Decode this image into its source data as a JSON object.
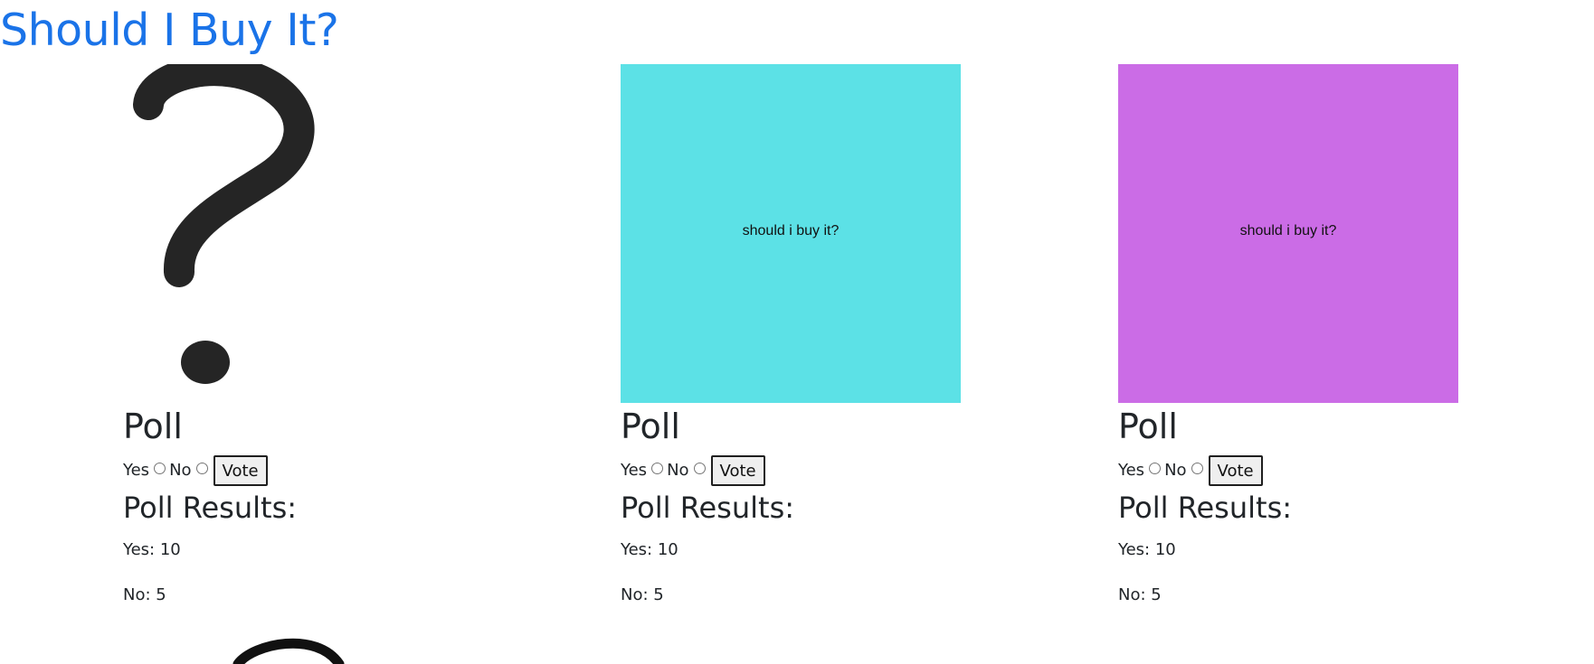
{
  "page": {
    "title": "Should I Buy It?"
  },
  "cards": [
    {
      "image_label": "",
      "image_icon": "question-mark-icon",
      "poll_title": "Poll",
      "options": {
        "yes": "Yes",
        "no": "No"
      },
      "vote_button": "Vote",
      "results_title": "Poll Results:",
      "yes_result": "Yes: 10",
      "no_result": "No: 5"
    },
    {
      "image_label": "should i buy it?",
      "image_color": "#5ce1e6",
      "poll_title": "Poll",
      "options": {
        "yes": "Yes",
        "no": "No"
      },
      "vote_button": "Vote",
      "results_title": "Poll Results:",
      "yes_result": "Yes: 10",
      "no_result": "No: 5"
    },
    {
      "image_label": "should i buy it?",
      "image_color": "#cb6ce6",
      "poll_title": "Poll",
      "options": {
        "yes": "Yes",
        "no": "No"
      },
      "vote_button": "Vote",
      "results_title": "Poll Results:",
      "yes_result": "Yes: 10",
      "no_result": "No: 5"
    }
  ]
}
